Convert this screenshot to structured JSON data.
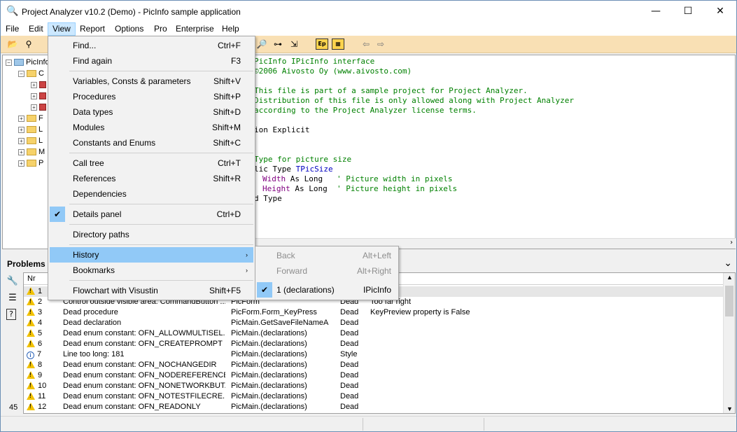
{
  "window": {
    "title": "Project Analyzer v10.2 (Demo) - PicInfo sample application",
    "minimize": "—",
    "maximize": "☐",
    "close": "✕"
  },
  "menubar": {
    "items": [
      "File",
      "Edit",
      "View",
      "Report",
      "Options",
      "Pro",
      "Enterprise",
      "Help"
    ],
    "active": "View"
  },
  "toolbar": {
    "buttons": [
      "open-icon",
      "find-binoculars-icon",
      "zoom-icon",
      "tree-icon",
      "procedures-icon",
      "ep-icon",
      "chart-icon",
      "back-arrow-icon",
      "forward-arrow-icon"
    ],
    "ep_label": "Ep"
  },
  "tree": {
    "root": "PicInfo",
    "child1": "C",
    "folders": [
      "F",
      "L",
      "L",
      "M",
      "P"
    ]
  },
  "code": {
    "lines": [
      {
        "text": "PicInfo IPicInfo interface",
        "color": "green"
      },
      {
        "text": "©2006 Aivosto Oy (www.aivosto.com)",
        "color": "green"
      },
      {
        "text": "",
        "color": "black"
      },
      {
        "text": "This file is part of a sample project for Project Analyzer.",
        "color": "green"
      },
      {
        "text": "Distribution of this file is only allowed along with Project Analyzer",
        "color": "green"
      },
      {
        "text": "according to the Project Analyzer license terms.",
        "color": "green"
      },
      {
        "text": "",
        "color": "black"
      },
      {
        "text": "ion Explicit",
        "color": "black"
      },
      {
        "text": "",
        "color": "black"
      },
      {
        "text": "",
        "color": "black"
      },
      {
        "text": "Type for picture size",
        "color": "green"
      },
      {
        "text": "lic Type TPicSize",
        "color": "black"
      },
      {
        "text": "  Width As Long   ' Picture width in pixels",
        "color": "mixed"
      },
      {
        "text": "  Height As Long  ' Picture height in pixels",
        "color": "mixed"
      },
      {
        "text": "d Type",
        "color": "black"
      }
    ],
    "tpicsize": "TPicSize",
    "width_kw": "Width",
    "height_kw": "Height",
    "as_long": "As Long",
    "width_comment": "' Picture width in pixels",
    "height_comment": "' Picture height in pixels",
    "line12_prefix": "lic Type "
  },
  "problems": {
    "title": "Problems",
    "count": "45",
    "columns": [
      "Nr",
      "",
      "",
      "",
      ""
    ],
    "rows": [
      {
        "nr": "1",
        "icon": "warning",
        "desc": "",
        "location": "",
        "type": "",
        "detail": ""
      },
      {
        "nr": "2",
        "icon": "warning",
        "desc": "Control outside visible area: CommandButton ...",
        "location": "PicForm",
        "type": "Dead",
        "detail": "Too far right"
      },
      {
        "nr": "3",
        "icon": "warning",
        "desc": "Dead procedure",
        "location": "PicForm.Form_KeyPress",
        "type": "Dead",
        "detail": "KeyPreview property is False"
      },
      {
        "nr": "4",
        "icon": "warning",
        "desc": "Dead declaration",
        "location": "PicMain.GetSaveFileNameA",
        "type": "Dead",
        "detail": ""
      },
      {
        "nr": "5",
        "icon": "warning",
        "desc": "Dead enum constant: OFN_ALLOWMULTISEL...",
        "location": "PicMain.(declarations)",
        "type": "Dead",
        "detail": ""
      },
      {
        "nr": "6",
        "icon": "warning",
        "desc": "Dead enum constant: OFN_CREATEPROMPT",
        "location": "PicMain.(declarations)",
        "type": "Dead",
        "detail": ""
      },
      {
        "nr": "7",
        "icon": "info",
        "desc": "Line too long: 181",
        "location": "PicMain.(declarations)",
        "type": "Style",
        "detail": ""
      },
      {
        "nr": "8",
        "icon": "warning",
        "desc": "Dead enum constant: OFN_NOCHANGEDIR",
        "location": "PicMain.(declarations)",
        "type": "Dead",
        "detail": ""
      },
      {
        "nr": "9",
        "icon": "warning",
        "desc": "Dead enum constant: OFN_NODEREFERENCE...",
        "location": "PicMain.(declarations)",
        "type": "Dead",
        "detail": ""
      },
      {
        "nr": "10",
        "icon": "warning",
        "desc": "Dead enum constant: OFN_NONETWORKBUT...",
        "location": "PicMain.(declarations)",
        "type": "Dead",
        "detail": ""
      },
      {
        "nr": "11",
        "icon": "warning",
        "desc": "Dead enum constant: OFN_NOTESTFILECRE...",
        "location": "PicMain.(declarations)",
        "type": "Dead",
        "detail": ""
      },
      {
        "nr": "12",
        "icon": "warning",
        "desc": "Dead enum constant: OFN_READONLY",
        "location": "PicMain.(declarations)",
        "type": "Dead",
        "detail": ""
      }
    ]
  },
  "view_menu": {
    "items": [
      {
        "label": "Find...",
        "shortcut": "Ctrl+F"
      },
      {
        "label": "Find again",
        "shortcut": "F3"
      },
      {
        "label": "Variables, Consts & parameters",
        "shortcut": "Shift+V"
      },
      {
        "label": "Procedures",
        "shortcut": "Shift+P"
      },
      {
        "label": "Data types",
        "shortcut": "Shift+D"
      },
      {
        "label": "Modules",
        "shortcut": "Shift+M"
      },
      {
        "label": "Constants and Enums",
        "shortcut": "Shift+C"
      },
      {
        "label": "Call tree",
        "shortcut": "Ctrl+T"
      },
      {
        "label": "References",
        "shortcut": "Shift+R"
      },
      {
        "label": "Dependencies",
        "shortcut": ""
      },
      {
        "label": "Details panel",
        "shortcut": "Ctrl+D"
      },
      {
        "label": "Directory paths",
        "shortcut": ""
      },
      {
        "label": "History",
        "shortcut": ""
      },
      {
        "label": "Bookmarks",
        "shortcut": ""
      },
      {
        "label": "Flowchart with Visustin",
        "shortcut": "Shift+F5"
      }
    ],
    "check": "✔",
    "submenu_arrow": "›"
  },
  "history_menu": {
    "items": [
      {
        "label": "Back",
        "shortcut": "Alt+Left",
        "enabled": false
      },
      {
        "label": "Forward",
        "shortcut": "Alt+Right",
        "enabled": false
      },
      {
        "label": "1 (declarations)",
        "shortcut": "IPicInfo",
        "enabled": true,
        "checked": true
      }
    ]
  },
  "colors": {
    "toolbar_bg": "#f9e0b4",
    "menu_highlight": "#91c9f7",
    "comment_green": "#008000",
    "keyword_purple": "#800080"
  }
}
